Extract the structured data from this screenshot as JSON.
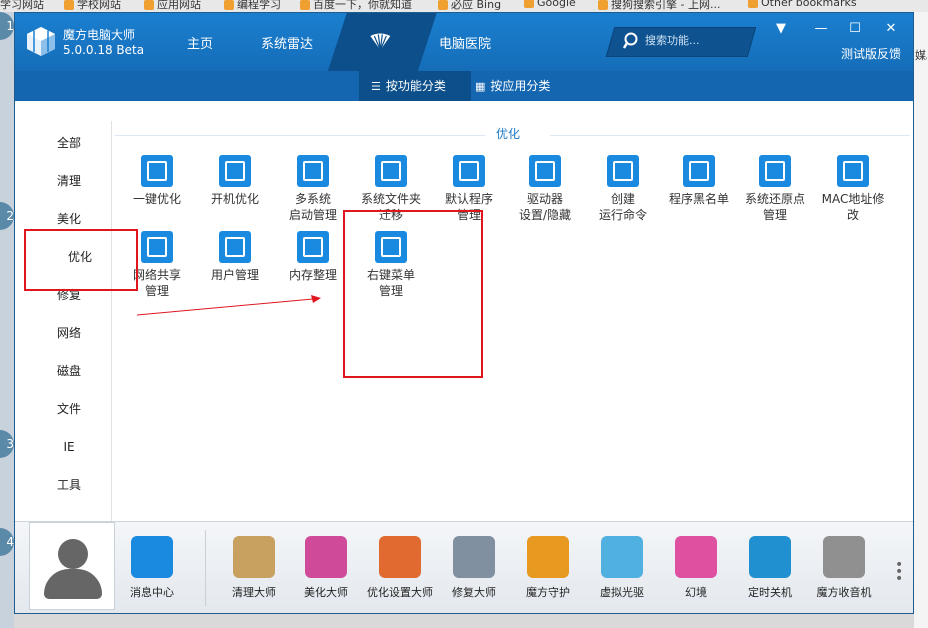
{
  "bookmarks": [
    "学习网站",
    "学校网站",
    "应用网站",
    "编程学习",
    "百度一下，你就知道",
    "必应 Bing",
    "Google",
    "搜狗搜索引擎 - 上网...",
    "Other bookmarks"
  ],
  "background": {
    "left_numbers": [
      "1",
      "2",
      "3",
      "4"
    ],
    "right_text": "媒。"
  },
  "app": {
    "name": "魔方电脑大师",
    "version": "5.0.0.18 Beta",
    "nav": [
      "主页",
      "系统雷达",
      "电脑医院"
    ],
    "search_placeholder": "搜索功能...",
    "window_buttons": {
      "menu": "▼",
      "minimize": "—",
      "maximize": "☐",
      "close": "✕"
    },
    "feedback": "测试版反馈",
    "subtabs": {
      "by_function": "按功能分类",
      "by_app": "按应用分类"
    }
  },
  "sidebar": [
    "全部",
    "清理",
    "美化",
    "优化",
    "修复",
    "网络",
    "磁盘",
    "文件",
    "IE",
    "工具"
  ],
  "section_title": "优化",
  "tiles": [
    {
      "label": "一键优化",
      "icon": "rocket-icon"
    },
    {
      "label": "开机优化",
      "icon": "boot-icon"
    },
    {
      "label": "多系统\n启动管理",
      "icon": "multi-boot-icon"
    },
    {
      "label": "系统文件夹\n迁移",
      "icon": "folder-move-icon"
    },
    {
      "label": "默认程序\n管理",
      "icon": "default-program-icon"
    },
    {
      "label": "驱动器\n设置/隐藏",
      "icon": "drive-icon"
    },
    {
      "label": "创建\n运行命令",
      "icon": "run-command-icon"
    },
    {
      "label": "程序黑名单",
      "icon": "blacklist-icon"
    },
    {
      "label": "系统还原点\n管理",
      "icon": "restore-icon"
    },
    {
      "label": "MAC地址修\n改",
      "icon": "mac-address-icon"
    },
    {
      "label": "网络共享\n管理",
      "icon": "share-icon"
    },
    {
      "label": "用户管理",
      "icon": "user-icon"
    },
    {
      "label": "内存整理",
      "icon": "memory-icon"
    },
    {
      "label": "右键菜单\n管理",
      "icon": "context-menu-icon"
    }
  ],
  "bottom_tools": [
    {
      "label": "消息中心",
      "color": "#1a8ae0"
    },
    {
      "label": "清理大师",
      "color": "#c8a060"
    },
    {
      "label": "美化大师",
      "color": "#d04a9a"
    },
    {
      "label": "优化设置大师",
      "color": "#e06a30"
    },
    {
      "label": "修复大师",
      "color": "#8090a0"
    },
    {
      "label": "魔方守护",
      "color": "#e89a20"
    },
    {
      "label": "虚拟光驱",
      "color": "#50b0e0"
    },
    {
      "label": "幻境",
      "color": "#e050a0"
    },
    {
      "label": "定时关机",
      "color": "#2090d0"
    },
    {
      "label": "魔方收音机",
      "color": "#909090"
    }
  ],
  "colors": {
    "accent": "#1a7fd0",
    "highlight": "#e0161e"
  }
}
